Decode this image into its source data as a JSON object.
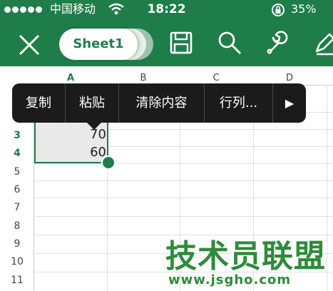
{
  "status_bar": {
    "carrier": "中国移动",
    "time": "18:22",
    "battery": "35%"
  },
  "toolbar": {
    "sheet_tab": "Sheet1",
    "icons": [
      "close-icon",
      "save-icon",
      "search-icon",
      "wrench-icon",
      "pen-icon"
    ]
  },
  "grid": {
    "columns": [
      "A",
      "B",
      "C",
      "D"
    ],
    "rows": [
      "3",
      "4",
      "5",
      "6",
      "7",
      "8",
      "9",
      "10",
      "11"
    ],
    "cells": {
      "A3": "70",
      "A4": "60"
    }
  },
  "context_menu": {
    "items": [
      "复制",
      "粘贴",
      "清除内容",
      "行列..."
    ],
    "more": "▶"
  },
  "watermark": {
    "title": "技术员联盟",
    "url": "www.jsgho.com"
  },
  "colors": {
    "brand_green": "#1f7d4a",
    "menu_bg": "#1b1b1b"
  }
}
